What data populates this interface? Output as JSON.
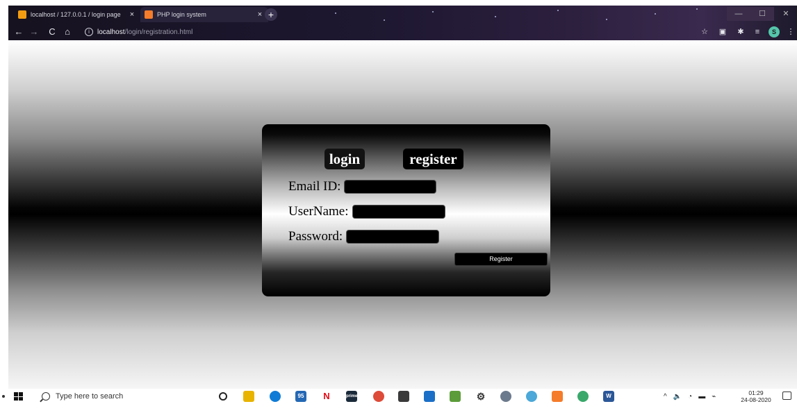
{
  "browser": {
    "tabs": [
      {
        "title": "localhost / 127.0.0.1 / login page",
        "favicon_color": "#f39c12"
      },
      {
        "title": "PHP login system",
        "favicon_color": "#f57c2a"
      }
    ],
    "tab_close_glyph": "×",
    "new_tab_glyph": "+",
    "window_controls": {
      "minimize": "—",
      "maximize": "☐",
      "close": "✕"
    },
    "nav": {
      "back": "←",
      "forward": "→",
      "reload": "C",
      "home": "⌂"
    },
    "address": {
      "info_glyph": "i",
      "host": "localhost",
      "path": "/login/registration.html"
    },
    "toolbar_icons": {
      "bookmark": "☆",
      "extension": "▣",
      "puzzle": "✱",
      "media": "≡",
      "profile": "S",
      "menu": "⋮"
    }
  },
  "page": {
    "background": "metallic-gradient",
    "switch": {
      "login_label": "login",
      "register_label": "register"
    },
    "fields": [
      {
        "id": "email",
        "label": "Email ID:",
        "value": ""
      },
      {
        "id": "username",
        "label": "UserName:",
        "value": ""
      },
      {
        "id": "password",
        "label": "Password:",
        "value": ""
      }
    ],
    "submit_label": "Register"
  },
  "taskbar": {
    "search_placeholder": "Type here to search",
    "apps": {
      "netflix": "N",
      "prime": "prime video",
      "settings": "⚙",
      "word": "W"
    },
    "mail_badge": "95",
    "tray": {
      "chevron": "^",
      "volume": "🔈",
      "wifi": "◔",
      "battery": "▬",
      "network": "⌁"
    },
    "clock": {
      "time": "01:29",
      "date": "24-08-2020"
    }
  }
}
